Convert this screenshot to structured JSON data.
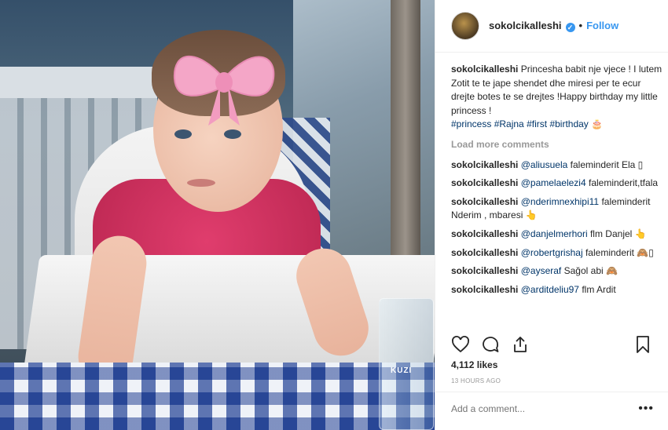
{
  "post": {
    "username": "sokolcikalleshi",
    "verified_mark": "✓",
    "dot": "•",
    "follow_label": "Follow",
    "caption_user": "sokolcikalleshi",
    "caption_text": "Princesha babit nje vjece ! I lutem Zotit te te jape shendet dhe miresi per te ecur drejte botes te se drejtes !Happy birthday my little princess !",
    "hashtags": [
      "#princess",
      "#Rajna",
      "#first",
      "#birthday"
    ],
    "caption_emoji": "🎂",
    "load_more_label": "Load more comments",
    "comments": [
      {
        "user": "sokolcikalleshi",
        "mention": "@aliusuela",
        "text": "faleminderit Ela ▯"
      },
      {
        "user": "sokolcikalleshi",
        "mention": "@pamelaelezi4",
        "text": "faleminderit,tfala"
      },
      {
        "user": "sokolcikalleshi",
        "mention": "@nderimnexhipi11",
        "text": "faleminderit Nderim , mbaresi 👆"
      },
      {
        "user": "sokolcikalleshi",
        "mention": "@danjelmerhori",
        "text": "flm Danjel 👆"
      },
      {
        "user": "sokolcikalleshi",
        "mention": "@robertgrishaj",
        "text": "faleminderit 🙈▯"
      },
      {
        "user": "sokolcikalleshi",
        "mention": "@ayseraf",
        "text": "Sağol abi 🙈"
      },
      {
        "user": "sokolcikalleshi",
        "mention": "@arditdeliu97",
        "text": "flm Ardit"
      }
    ],
    "likes": "4,112 likes",
    "time": "13 HOURS AGO",
    "add_comment_placeholder": "Add a comment...",
    "more_label": "•••",
    "glass_logo": "KUZI"
  },
  "icons": {
    "like": "heart-icon",
    "comment": "comment-icon",
    "share": "share-icon",
    "save": "bookmark-icon"
  },
  "colors": {
    "link": "#3897f0",
    "hashtag": "#003569",
    "muted": "#999999"
  }
}
